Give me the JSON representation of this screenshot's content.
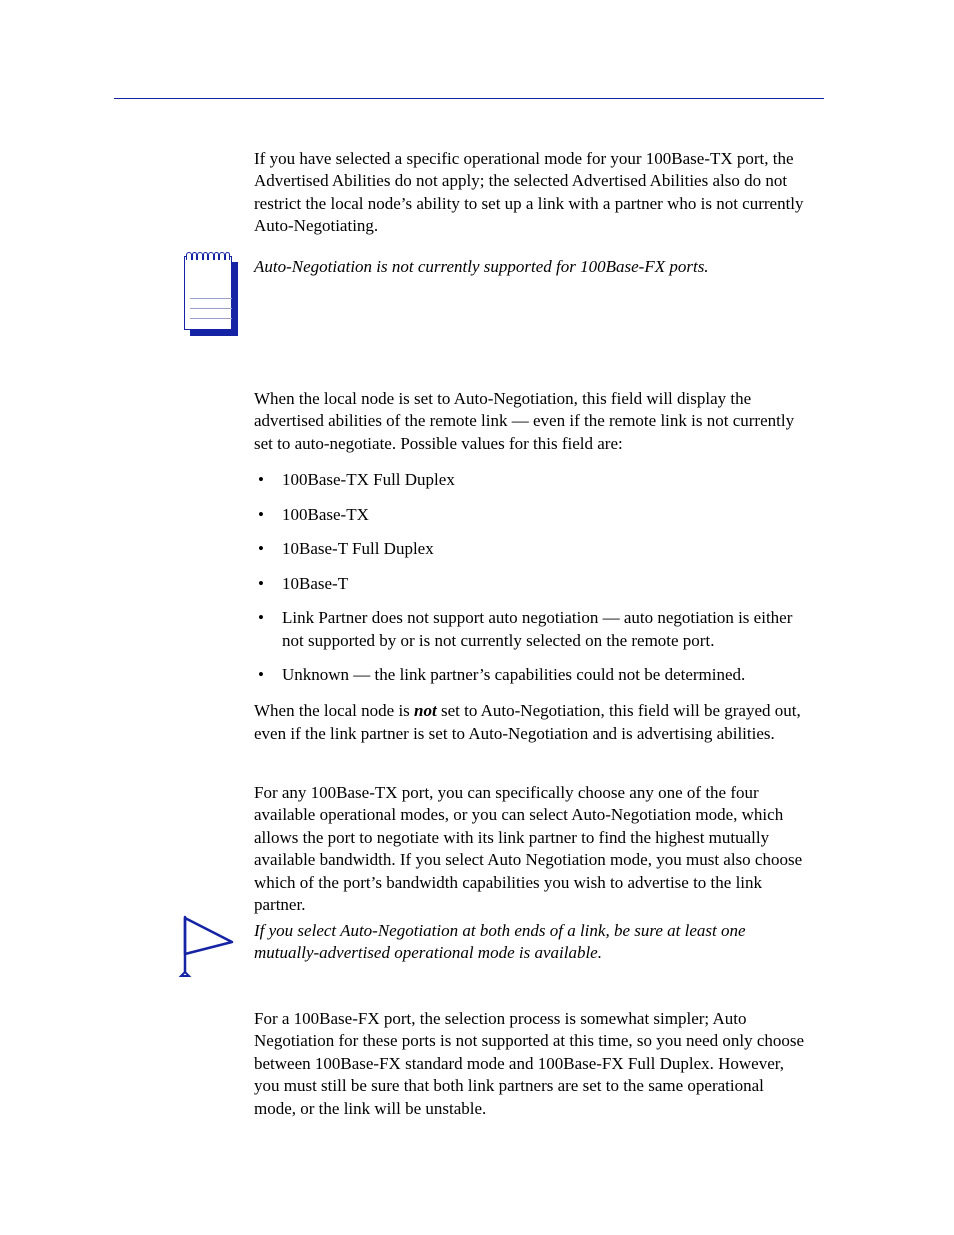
{
  "intro_para": "If you have selected a specific operational mode for your 100Base-TX port, the Advertised Abilities do not apply; the selected Advertised Abilities also do not restrict the local node’s ability to set up a link with a partner who is not currently Auto-Negotiating.",
  "note_text": "Auto-Negotiation is not currently supported for 100Base-FX ports.",
  "remote_intro": "When the local node is set to Auto-Negotiation, this field will display the advertised abilities of the remote link — even if the remote link is not currently set to auto-negotiate. Possible values for this field are:",
  "bullets": [
    "100Base-TX Full Duplex",
    "100Base-TX",
    "10Base-T Full Duplex",
    "10Base-T",
    "Link Partner does not support auto negotiation — auto negotiation is either not supported by or is not currently selected on the remote port.",
    "Unknown — the link partner’s capabilities could not be determined."
  ],
  "not_auto_pre": "When the local node is ",
  "not_word": "not",
  "not_auto_post": " set to Auto-Negotiation, this field will be grayed out, even if the link partner is set to Auto-Negotiation and is advertising abilities.",
  "tx_para": "For any 100Base-TX port, you can specifically choose any one of the four available operational modes, or you can select Auto-Negotiation mode, which allows the port to negotiate with its link partner to find the highest mutually available bandwidth. If you select Auto Negotiation mode, you must also choose which of the port’s bandwidth capabilities you wish to advertise to the link partner.",
  "caution_text": "If you select Auto-Negotiation at both ends of a link, be sure at least one mutually-advertised operational mode is available.",
  "fx_para": "For a 100Base-FX port, the selection process is somewhat simpler; Auto Negotiation for these ports is not supported at this time, so you need only choose between 100Base-FX standard mode and 100Base-FX Full Duplex. However, you must still be sure that both link partners are set to the same operational mode, or the link will be unstable."
}
